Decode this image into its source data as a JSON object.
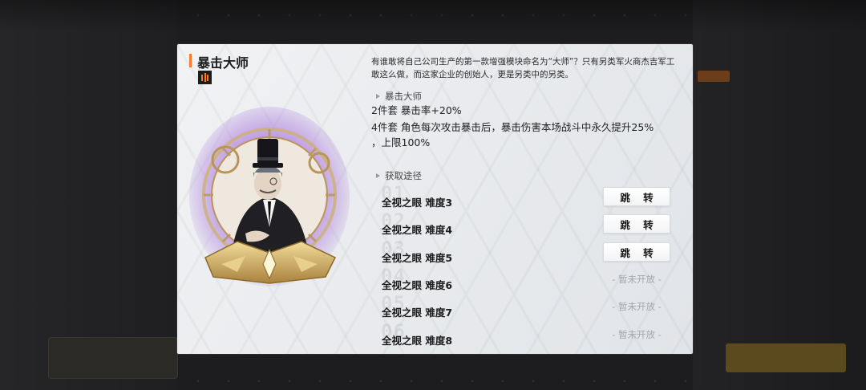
{
  "modal": {
    "title": "暴击大师",
    "description": "有谁敢将自己公司生产的第一款增强模块命名为“大师”？只有另类军火商杰吉军工敢这么做，而这家企业的创始人，更是另类中的另类。",
    "set_section_title": "暴击大师",
    "bonus_2": "2件套  暴击率+20%",
    "bonus_4_line1": "4件套  角色每次攻击暴击后，暴击伤害本场战斗中永久提升25%",
    "bonus_4_line2": "，上限100%",
    "acquire_section_title": "获取途径",
    "routes": [
      {
        "num": "01",
        "label": "全视之眼  难度3",
        "action": "跳 转",
        "available": true
      },
      {
        "num": "02",
        "label": "全视之眼  难度4",
        "action": "跳 转",
        "available": true
      },
      {
        "num": "03",
        "label": "全视之眼  难度5",
        "action": "跳 转",
        "available": true
      },
      {
        "num": "04",
        "label": "全视之眼  难度6",
        "action": "- 暂未开放 -",
        "available": false
      },
      {
        "num": "05",
        "label": "全视之眼  难度7",
        "action": "- 暂未开放 -",
        "available": false
      },
      {
        "num": "06",
        "label": "全视之眼  难度8",
        "action": "- 暂未开放 -",
        "available": false
      }
    ]
  },
  "colors": {
    "accent": "#ff7a2a",
    "glow": "#b98ae0",
    "gold": "#c9a35a"
  },
  "icons": {
    "set_badge": "rarity-bars-icon",
    "section_marker": "triangle-right-icon",
    "portrait": "gentleman-top-hat-portrait"
  }
}
